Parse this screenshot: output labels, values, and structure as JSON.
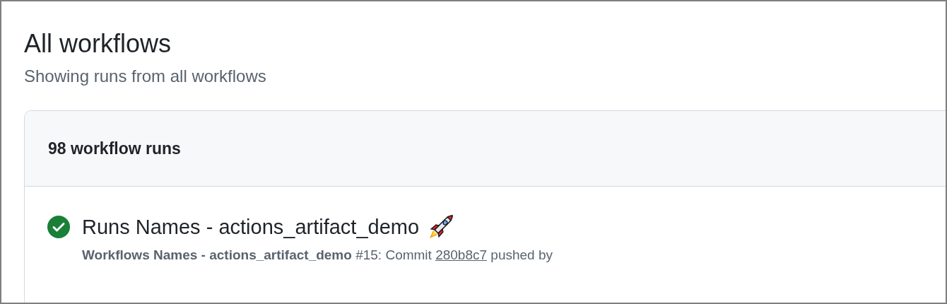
{
  "title": "All workflows",
  "subtitle": "Showing runs from all workflows",
  "runs_panel": {
    "count_label": "98 workflow runs",
    "runs": [
      {
        "succeeded": true,
        "title": "Runs Names - actions_artifact_demo",
        "meta": "**Workflows Names - actions_artifact_demo** #15: Commit",
        "commit": "280b8c7",
        "meta_end": "pushed by"
      }
    ]
  }
}
